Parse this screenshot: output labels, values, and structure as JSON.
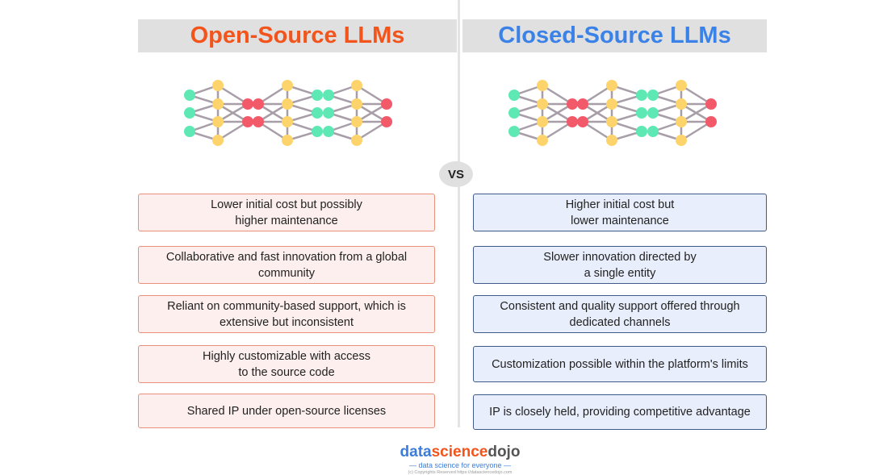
{
  "colors": {
    "open_accent": "#f2541b",
    "closed_accent": "#3b82e8",
    "node_input": "#5de8b4",
    "node_hidden": "#fdd46b",
    "node_output": "#f25a6a",
    "edge": "#a89ea8"
  },
  "left": {
    "title": "Open-Source LLMs",
    "points": [
      "Lower initial cost but possibly\nhigher maintenance",
      "Collaborative and fast innovation from a global community",
      "Reliant on community-based support, which is extensive but inconsistent",
      "Highly customizable with access\nto the source code",
      "Shared IP under open-source licenses"
    ]
  },
  "right": {
    "title": "Closed-Source LLMs",
    "points": [
      "Higher initial cost but\nlower maintenance",
      "Slower innovation directed by\na single entity",
      "Consistent and quality support offered through dedicated channels",
      "Customization possible within the platform's limits",
      "IP is closely held, providing competitive advantage"
    ]
  },
  "vs_label": "VS",
  "branding": {
    "logo_part1": "data",
    "logo_part2": "science",
    "logo_part3": "dojo",
    "tagline": "data science for everyone",
    "copyright": "(c) Copyrights Reserved  https://datasciencedojo.com"
  }
}
